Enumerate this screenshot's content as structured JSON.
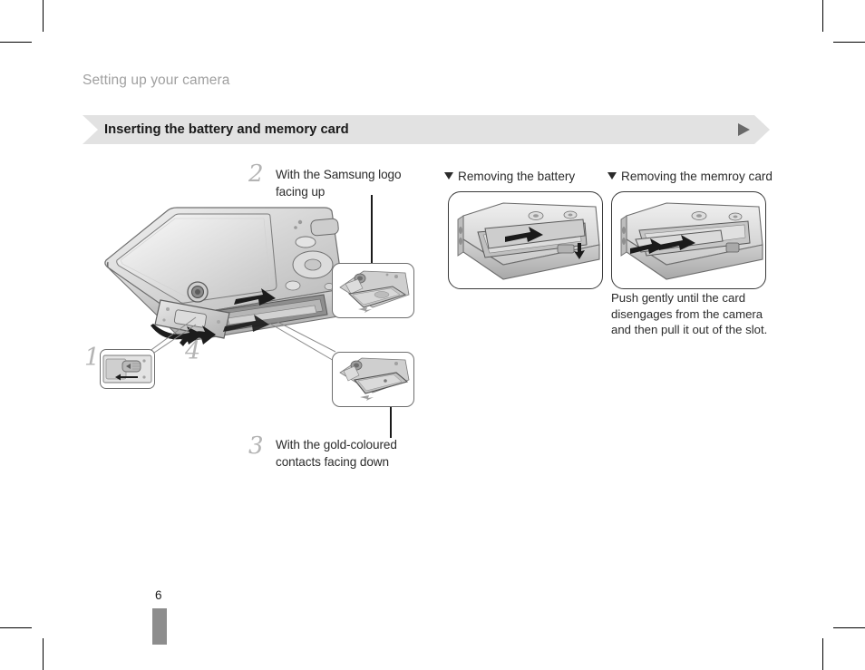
{
  "document": {
    "section_label": "Setting up your camera",
    "title": "Inserting the battery and memory card",
    "page_number": "6"
  },
  "steps": [
    {
      "number": "1",
      "text": ""
    },
    {
      "number": "2",
      "text": "With the Samsung logo facing up"
    },
    {
      "number": "3",
      "text": "With the gold-coloured contacts facing down"
    },
    {
      "number": "4",
      "text": ""
    }
  ],
  "right_column": {
    "battery_heading": "Removing the battery",
    "card_heading": "Removing the memroy card",
    "note": "Push gently until the card disengages from the camera and then pull it out of the slot."
  },
  "colors": {
    "title_bar_bg": "#e2e2e2",
    "section_label": "#a0a0a0",
    "step_number": "#b4b4b4",
    "body_text": "#2b2b2b",
    "page_tab": "#8d8d8d"
  }
}
